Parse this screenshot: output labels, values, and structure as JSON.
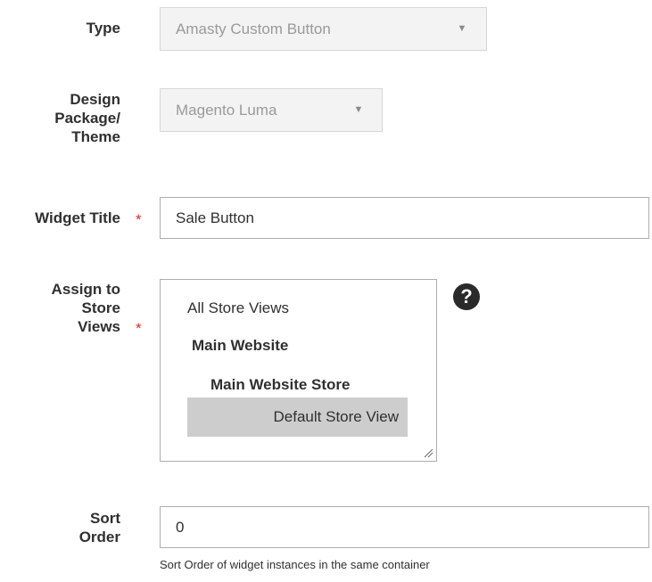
{
  "type_field": {
    "label": "Type",
    "value": "Amasty Custom Button"
  },
  "theme_field": {
    "label_lines": [
      "Design",
      "Package/",
      "Theme"
    ],
    "value": "Magento Luma"
  },
  "widget_title_field": {
    "label": "Widget Title",
    "required_mark": "*",
    "value": "Sale Button"
  },
  "store_views_field": {
    "label_lines": [
      "Assign to",
      "Store",
      "Views"
    ],
    "required_mark": "*",
    "options": [
      "All Store Views",
      "Main Website",
      "Main Website Store",
      "Default Store View"
    ],
    "selected": "Default Store View",
    "help_icon": "question-circle-icon",
    "help_glyph": "?"
  },
  "sort_order_field": {
    "label_lines": [
      "Sort",
      "Order"
    ],
    "value": "0",
    "note": "Sort Order of widget instances in the same container"
  },
  "caret_glyph": "▼",
  "colors": {
    "required": "#e22626",
    "selected_option_bg": "#cdcdcd",
    "disabled_bg": "#f3f3f3"
  }
}
